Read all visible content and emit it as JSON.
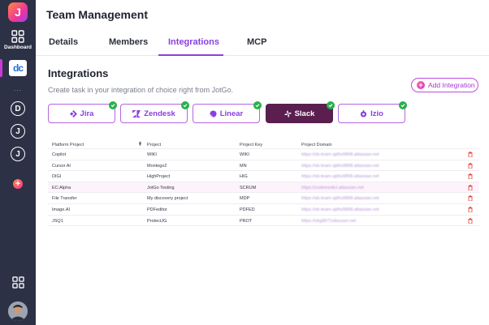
{
  "sidebar": {
    "logo_letter": "J",
    "dashboard_label": "Dashboard",
    "active_workspace": "dc",
    "dots": "...",
    "workspaces": [
      "D",
      "J",
      "J"
    ]
  },
  "header": {
    "title": "Team Management"
  },
  "tabs": [
    "Details",
    "Members",
    "Integrations",
    "MCP"
  ],
  "integrations": {
    "title": "Integrations",
    "subtitle": "Create task in your integration of choice right from JotGo.",
    "add_button": "Add Integration",
    "cards": [
      {
        "label": "Jira",
        "icon": "jira-icon",
        "connected": true,
        "selected": false
      },
      {
        "label": "Zendesk",
        "icon": "zendesk-icon",
        "connected": true,
        "selected": false
      },
      {
        "label": "Linear",
        "icon": "linear-icon",
        "connected": true,
        "selected": false
      },
      {
        "label": "Slack",
        "icon": "slack-icon",
        "connected": true,
        "selected": true
      },
      {
        "label": "Izio",
        "icon": "izio-icon",
        "connected": true,
        "selected": false
      }
    ]
  },
  "table": {
    "columns": [
      "Platform Project",
      "Project",
      "Project Key",
      "Project Domain"
    ],
    "rows": [
      {
        "platform": "Copilot",
        "project": "WIKI",
        "key": "WIKI",
        "domain": "https://sb-team-sjdhs9898.atlassian.net"
      },
      {
        "platform": "Cursor AI",
        "project": "Montego2",
        "key": "MN",
        "domain": "https://sb-team-sjdhs9898.atlassian.net"
      },
      {
        "platform": "DIGI",
        "project": "HighProject",
        "key": "HIG",
        "domain": "https://sb-team-sjdhs9898.atlassian.net"
      },
      {
        "platform": "EC:Alpha",
        "project": "JotGo Testing",
        "key": "SCRUM",
        "domain": "https://codemedicl.atlassian.net"
      },
      {
        "platform": "File Transfer",
        "project": "My discovery project",
        "key": "MDP",
        "domain": "https://sb-team-sjdhs9898.atlassian.net"
      },
      {
        "platform": "Image.AI",
        "project": "PDFeditor",
        "key": "PDFED",
        "domain": "https://sb-team-sjdhs9898.atlassian.net"
      },
      {
        "platform": "JSQ1",
        "project": "ProtectJG",
        "key": "PROT",
        "domain": "https://sbg8971nikouser.net"
      }
    ]
  },
  "colors": {
    "accent": "#8a3fe0",
    "sidebar": "#2c3146",
    "selected_card": "#5a1f4f",
    "connected": "#27b14a",
    "delete": "#e0413a"
  }
}
